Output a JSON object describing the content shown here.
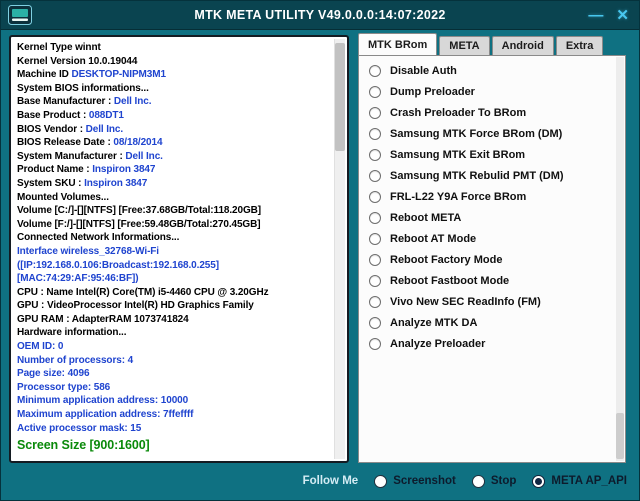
{
  "window": {
    "title": "MTK META UTILITY V49.0.0.0:14:07:2022",
    "minimize_glyph": "—",
    "close_glyph": "✕"
  },
  "colors": {
    "window_bg": "#0f7182",
    "titlebar_bg": "#0a4450",
    "control_icon": "#49c8f0",
    "info_value_blue": "#1f44cf",
    "screen_size_green": "#0a8a0a",
    "selected_radio": "#122642"
  },
  "system_info": {
    "lines": [
      [
        {
          "t": "Kernel Type winnt",
          "c": "k"
        }
      ],
      [
        {
          "t": "Kernel Version 10.0.19044",
          "c": "k"
        }
      ],
      [
        {
          "t": "Machine ID ",
          "c": "k"
        },
        {
          "t": "DESKTOP-NIPM3M1",
          "c": "b"
        }
      ],
      [
        {
          "t": "System BIOS informations...",
          "c": "k"
        }
      ],
      [
        {
          "t": "Base Manufacturer : ",
          "c": "k"
        },
        {
          "t": "Dell Inc.",
          "c": "b"
        }
      ],
      [
        {
          "t": "Base Product : ",
          "c": "k"
        },
        {
          "t": "088DT1",
          "c": "b"
        }
      ],
      [
        {
          "t": "BIOS Vendor : ",
          "c": "k"
        },
        {
          "t": "Dell Inc.",
          "c": "b"
        }
      ],
      [
        {
          "t": "BIOS Release Date : ",
          "c": "k"
        },
        {
          "t": "08/18/2014",
          "c": "b"
        }
      ],
      [
        {
          "t": "System Manufacturer : ",
          "c": "k"
        },
        {
          "t": "Dell Inc.",
          "c": "b"
        }
      ],
      [
        {
          "t": "Product Name : ",
          "c": "k"
        },
        {
          "t": "Inspiron 3847",
          "c": "b"
        }
      ],
      [
        {
          "t": "System SKU : ",
          "c": "k"
        },
        {
          "t": "Inspiron 3847",
          "c": "b"
        }
      ],
      [
        {
          "t": "Mounted Volumes...",
          "c": "k"
        }
      ],
      [
        {
          "t": "Volume [C:/]-[][NTFS] [Free:37.68GB/Total:118.20GB]",
          "c": "k"
        }
      ],
      [
        {
          "t": "Volume [F:/]-[][NTFS] [Free:59.48GB/Total:270.45GB]",
          "c": "k"
        }
      ],
      [
        {
          "t": "Connected Network Informations...",
          "c": "k"
        }
      ],
      [
        {
          "t": "Interface wireless_32768-Wi-Fi ([IP:192.168.0.106:Broadcast:192.168.0.255][MAC:74:29:AF:95:46:BF])",
          "c": "b"
        }
      ],
      [
        {
          "t": "CPU  : Name Intel(R) Core(TM) i5-4460 CPU @ 3.20GHz",
          "c": "k"
        }
      ],
      [
        {
          "t": "GPU  : VideoProcessor Intel(R) HD Graphics Family",
          "c": "k"
        }
      ],
      [
        {
          "t": "GPU RAM  : AdapterRAM 1073741824",
          "c": "k"
        }
      ],
      [
        {
          "t": "Hardware information...",
          "c": "k"
        }
      ],
      [
        {
          "t": "OEM ID: 0",
          "c": "b"
        }
      ],
      [
        {
          "t": "Number of processors: 4",
          "c": "b"
        }
      ],
      [
        {
          "t": "Page size: 4096",
          "c": "b"
        }
      ],
      [
        {
          "t": "Processor type: 586",
          "c": "b"
        }
      ],
      [
        {
          "t": "Minimum application address: 10000",
          "c": "b"
        }
      ],
      [
        {
          "t": "Maximum application address: 7ffeffff",
          "c": "b"
        }
      ],
      [
        {
          "t": "Active processor mask: 15",
          "c": "b"
        }
      ],
      [
        {
          "t": "Screen Size [900:1600]",
          "c": "g"
        }
      ]
    ]
  },
  "tabs": [
    {
      "label": "MTK BRom",
      "active": true
    },
    {
      "label": "META",
      "active": false
    },
    {
      "label": "Android",
      "active": false
    },
    {
      "label": "Extra",
      "active": false
    }
  ],
  "options": [
    {
      "label": "Disable Auth",
      "checked": false
    },
    {
      "label": "Dump Preloader",
      "checked": false
    },
    {
      "label": "Crash Preloader To BRom",
      "checked": false
    },
    {
      "label": "Samsung MTK Force BRom (DM)",
      "checked": false
    },
    {
      "label": "Samsung MTK Exit BRom",
      "checked": false
    },
    {
      "label": "Samsung MTK Rebulid PMT (DM)",
      "checked": false
    },
    {
      "label": "FRL-L22 Y9A Force BRom",
      "checked": false
    },
    {
      "label": "Reboot META",
      "checked": false
    },
    {
      "label": "Reboot AT Mode",
      "checked": false
    },
    {
      "label": "Reboot Factory Mode",
      "checked": false
    },
    {
      "label": "Reboot Fastboot Mode",
      "checked": false
    },
    {
      "label": "Vivo New SEC ReadInfo (FM)",
      "checked": false
    },
    {
      "label": "Analyze MTK DA",
      "checked": false
    },
    {
      "label": "Analyze Preloader",
      "checked": false
    }
  ],
  "footer": {
    "follow_label": "Follow Me",
    "radios": [
      {
        "label": "Screenshot",
        "checked": false
      },
      {
        "label": "Stop",
        "checked": false
      },
      {
        "label": "META AP_API",
        "checked": true
      }
    ]
  }
}
